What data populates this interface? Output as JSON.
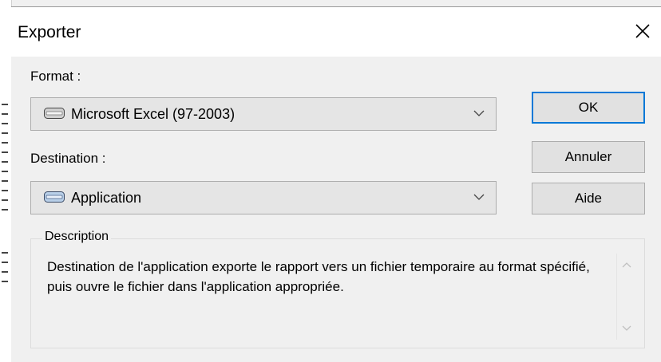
{
  "dialog": {
    "title": "Exporter",
    "close_icon": "close-icon"
  },
  "format": {
    "label": "Format :",
    "selected": "Microsoft Excel (97-2003)",
    "icon": "drive-icon"
  },
  "destination": {
    "label": "Destination :",
    "selected": "Application",
    "icon": "drive-icon"
  },
  "buttons": {
    "ok": "OK",
    "cancel": "Annuler",
    "help": "Aide"
  },
  "description": {
    "legend": "Description",
    "text": "Destination de l'application exporte le rapport vers un fichier temporaire au format spécifié, puis ouvre le fichier dans l'application appropriée."
  },
  "colors": {
    "dialog_bg": "#f0f0f0",
    "titlebar_bg": "#ffffff",
    "default_button_border": "#0078d7"
  }
}
